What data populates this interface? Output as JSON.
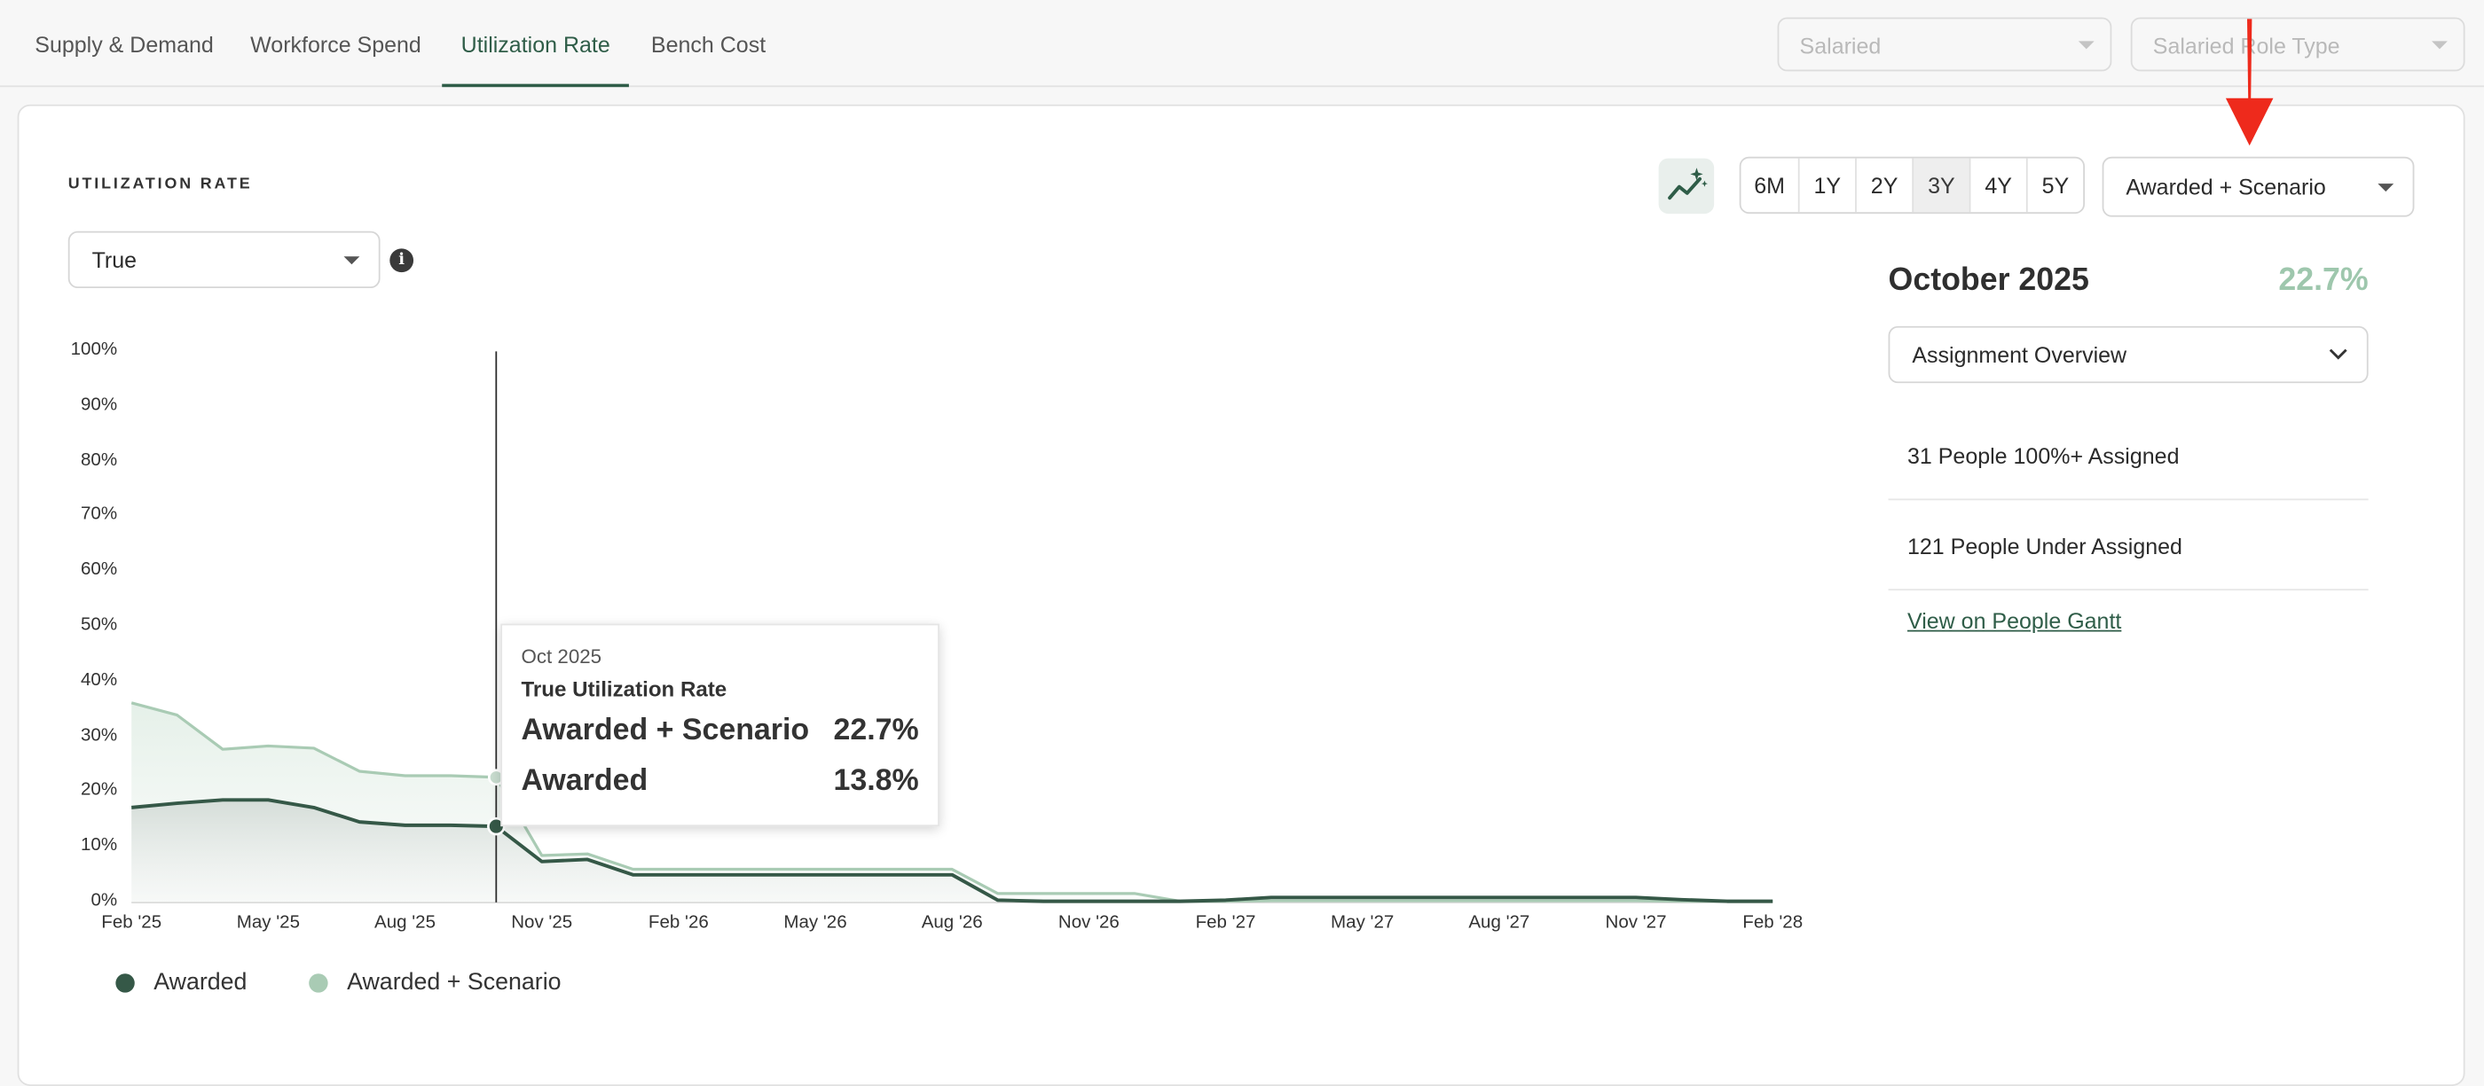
{
  "tabs": [
    {
      "label": "Supply & Demand",
      "active": false
    },
    {
      "label": "Workforce Spend",
      "active": false
    },
    {
      "label": "Utilization Rate",
      "active": true
    },
    {
      "label": "Bench Cost",
      "active": false
    }
  ],
  "filters": {
    "salaried": "Salaried",
    "role_type": "Salaried Role Type"
  },
  "section_title": "UTILIZATION RATE",
  "utilization_select": "True",
  "range_buttons": [
    "6M",
    "1Y",
    "2Y",
    "3Y",
    "4Y",
    "5Y"
  ],
  "range_active": "3Y",
  "scenario_select": "Awarded + Scenario",
  "panel": {
    "month": "October 2025",
    "percent": "22.7%",
    "overview_select": "Assignment Overview",
    "items": [
      "31 People 100%+ Assigned",
      "121 People Under Assigned"
    ],
    "link": "View on People Gantt"
  },
  "tooltip": {
    "date": "Oct 2025",
    "heading": "True Utilization Rate",
    "rows": [
      {
        "name": "Awarded + Scenario",
        "value": "22.7%"
      },
      {
        "name": "Awarded",
        "value": "13.8%"
      }
    ]
  },
  "colors": {
    "accent": "#2f5d48",
    "awarded": "#355847",
    "scenario": "#a9cbb4",
    "annotation_arrow": "#ee2a1c"
  },
  "icons": {
    "trend": "trend-sparkle-icon",
    "info": "info-icon",
    "chevron": "chevron-down-icon"
  },
  "chart_data": {
    "type": "area",
    "y_tick_labels": [
      "0%",
      "10%",
      "20%",
      "30%",
      "40%",
      "50%",
      "60%",
      "70%",
      "80%",
      "90%",
      "100%"
    ],
    "x_tick_labels": [
      "Feb '25",
      "May '25",
      "Aug '25",
      "Nov '25",
      "Feb '26",
      "May '26",
      "Aug '26",
      "Nov '26",
      "Feb '27",
      "May '27",
      "Aug '27",
      "Nov '27",
      "Feb '28"
    ],
    "ylim": [
      0,
      100
    ],
    "x": [
      "2025-02",
      "2025-03",
      "2025-04",
      "2025-05",
      "2025-06",
      "2025-07",
      "2025-08",
      "2025-09",
      "2025-10",
      "2025-11",
      "2025-12",
      "2026-01",
      "2026-02",
      "2026-03",
      "2026-04",
      "2026-05",
      "2026-06",
      "2026-07",
      "2026-08",
      "2026-09",
      "2026-10",
      "2026-11",
      "2026-12",
      "2027-01",
      "2027-02",
      "2027-03",
      "2027-04",
      "2027-05",
      "2027-06",
      "2027-07",
      "2027-08",
      "2027-09",
      "2027-10",
      "2027-11",
      "2027-12",
      "2028-01",
      "2028-02"
    ],
    "series": [
      {
        "name": "Awarded",
        "values": [
          17.2,
          18.0,
          18.6,
          18.6,
          17.2,
          14.6,
          14.0,
          14.0,
          13.8,
          7.4,
          7.8,
          5.0,
          5.0,
          5.0,
          5.0,
          5.0,
          5.0,
          5.0,
          5.0,
          0.4,
          0.2,
          0.2,
          0.2,
          0.2,
          0.4,
          0.9,
          0.9,
          0.9,
          0.9,
          0.9,
          0.9,
          0.9,
          0.9,
          0.9,
          0.5,
          0.2,
          0.2
        ]
      },
      {
        "name": "Awarded + Scenario",
        "values": [
          36.2,
          34.0,
          27.8,
          28.4,
          28.0,
          23.8,
          23.0,
          23.0,
          22.7,
          8.5,
          8.8,
          6.0,
          6.0,
          6.0,
          6.0,
          6.0,
          6.0,
          6.0,
          6.0,
          1.6,
          1.6,
          1.6,
          1.6,
          0.2,
          0.2,
          0.3,
          0.3,
          0.3,
          0.3,
          0.3,
          0.3,
          0.3,
          0.3,
          0.3,
          0.2,
          0.2,
          0.2
        ]
      }
    ],
    "highlight": "2025-10",
    "legend": [
      "Awarded",
      "Awarded + Scenario"
    ],
    "legend_position": "bottom-left"
  }
}
